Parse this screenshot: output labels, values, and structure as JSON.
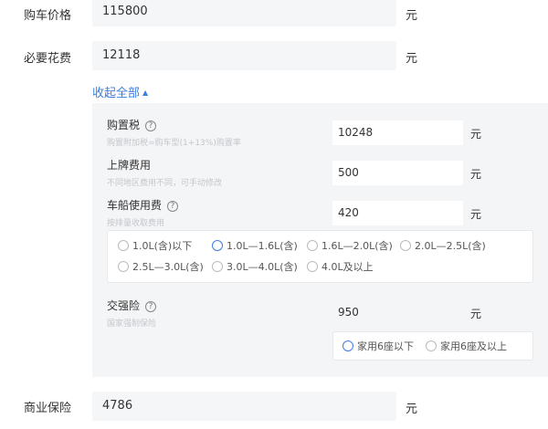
{
  "purchase_price": {
    "label": "购车价格",
    "value": "115800",
    "unit": "元"
  },
  "required_fees": {
    "label": "必要花费",
    "value": "12118",
    "unit": "元"
  },
  "collapse_link": {
    "label": "收起全部",
    "caret": "▲"
  },
  "purchase_tax": {
    "title": "购置税",
    "help": "?",
    "desc": "购置附加税=购车型(1+13%)购置率",
    "value": "10248",
    "unit": "元"
  },
  "license_fee": {
    "title": "上牌费用",
    "desc": "不同地区费用不同，可手动修改",
    "value": "500",
    "unit": "元"
  },
  "vehicle_tax": {
    "title": "车船使用费",
    "help": "?",
    "desc": "按排量收取费用",
    "value": "420",
    "unit": "元",
    "options": [
      "1.0L(含)以下",
      "1.0L—1.6L(含)",
      "1.6L—2.0L(含)",
      "2.0L—2.5L(含)",
      "2.5L—3.0L(含)",
      "3.0L—4.0L(含)",
      "4.0L及以上"
    ],
    "selected_index": 1
  },
  "compulsory_insurance": {
    "title": "交强险",
    "help": "?",
    "desc": "国家强制保险",
    "value": "950",
    "unit": "元",
    "options": [
      "家用6座以下",
      "家用6座及以上"
    ],
    "selected_index": 0
  },
  "commercial_insurance": {
    "label": "商业保险",
    "value": "4786",
    "unit": "元"
  },
  "colors": {
    "accent": "#3b7de0",
    "panel_bg": "#f4f5f7",
    "input_bg": "#f5f6f8"
  }
}
